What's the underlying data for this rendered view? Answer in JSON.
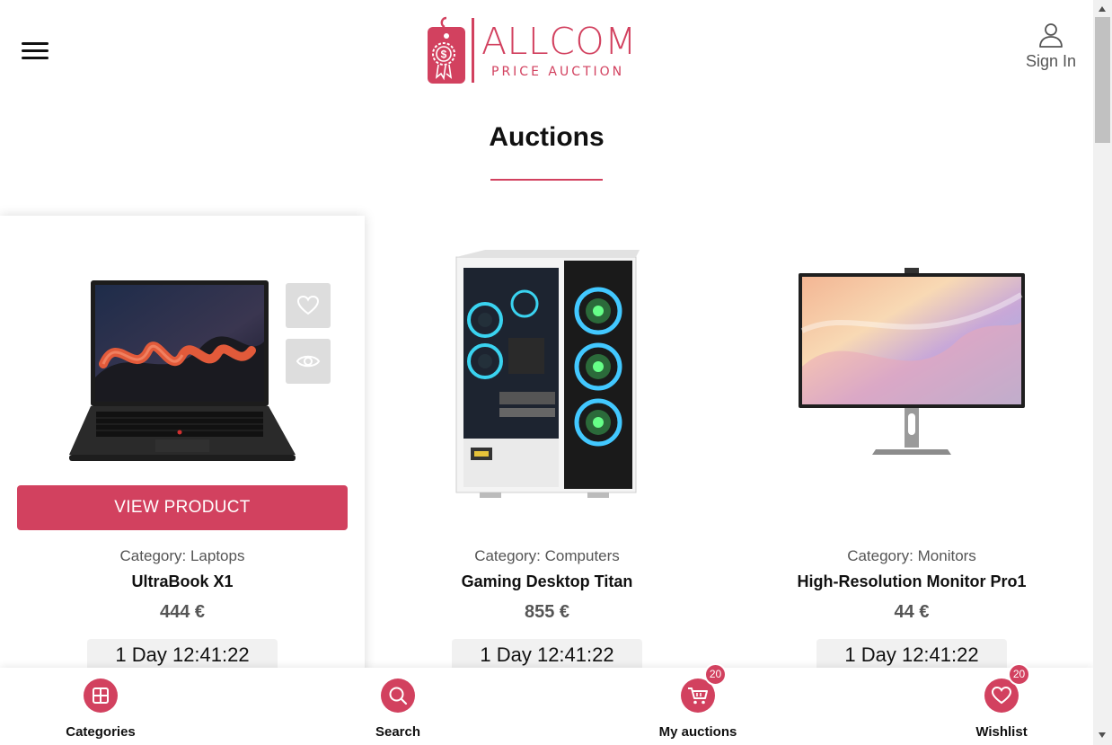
{
  "header": {
    "brand_name": "ALLCOM",
    "brand_tagline": "PRICE AUCTION",
    "signin_label": "Sign In"
  },
  "page": {
    "title": "Auctions"
  },
  "products": [
    {
      "category_label": "Category:",
      "category": "Laptops",
      "name": "UltraBook X1",
      "price": "444 €",
      "countdown": "1 Day 12:41:22",
      "button_label": "VIEW PRODUCT"
    },
    {
      "category_label": "Category:",
      "category": "Computers",
      "name": "Gaming Desktop Titan",
      "price": "855 €",
      "countdown": "1 Day 12:41:22"
    },
    {
      "category_label": "Category:",
      "category": "Monitors",
      "name": "High-Resolution Monitor Pro1",
      "price": "44 €",
      "countdown": "1 Day 12:41:22"
    }
  ],
  "bottom_nav": [
    {
      "label": "Categories",
      "icon": "grid-icon"
    },
    {
      "label": "Search",
      "icon": "search-icon"
    },
    {
      "label": "My auctions",
      "icon": "cart-icon",
      "badge": "20"
    },
    {
      "label": "Wishlist",
      "icon": "heart-icon",
      "badge": "20"
    }
  ],
  "colors": {
    "accent": "#d2415f",
    "countdown_bg": "#f1f1f1",
    "icon_button_bg": "#dddddd"
  }
}
